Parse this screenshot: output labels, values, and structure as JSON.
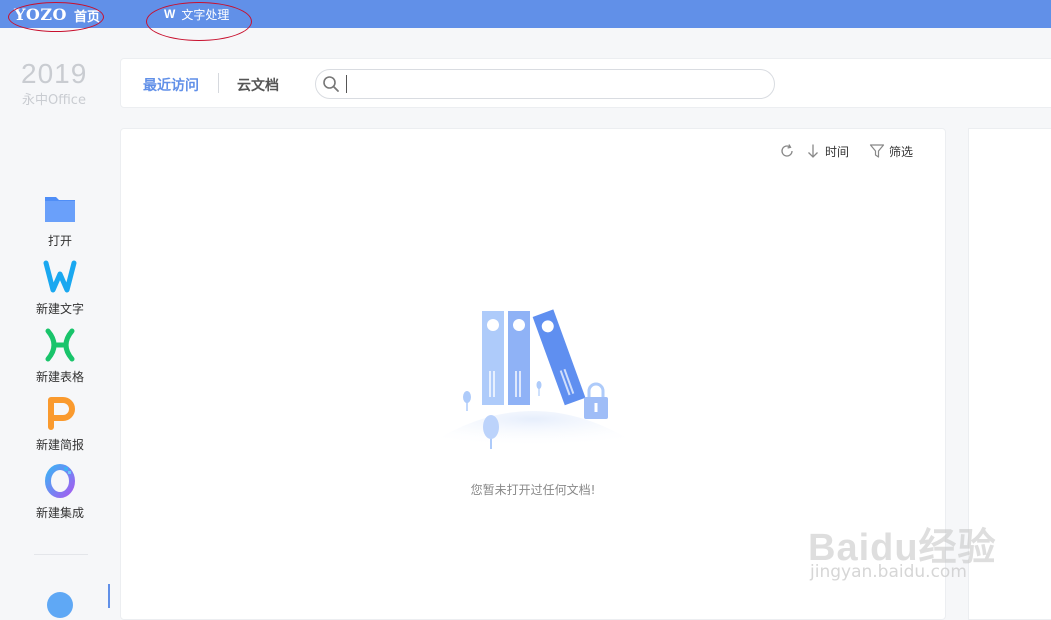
{
  "topbar": {
    "logo": "YOZO",
    "home_tab": "首页",
    "doc_tab_icon": "W",
    "doc_tab_label": "文字处理"
  },
  "brand": {
    "year": "2019",
    "name": "永中Office"
  },
  "sidebar": {
    "items": [
      {
        "label": "打开",
        "icon": "folder-icon",
        "color": "#4f8ef7"
      },
      {
        "label": "新建文字",
        "icon": "writer-w-icon",
        "color": "#1aa8f0"
      },
      {
        "label": "新建表格",
        "icon": "spreadsheet-x-icon",
        "color": "#19c46b"
      },
      {
        "label": "新建简报",
        "icon": "presentation-p-icon",
        "color": "#fa9a2e"
      },
      {
        "label": "新建集成",
        "icon": "integrated-icon",
        "color": "#8c6cf0"
      }
    ]
  },
  "header": {
    "tab_recent": "最近访问",
    "tab_cloud": "云文档",
    "search_placeholder": ""
  },
  "toolbar": {
    "sort_label": "时间",
    "filter_label": "筛选"
  },
  "empty": {
    "message": "您暂未打开过任何文档!"
  },
  "watermark": {
    "main": "Baidu经验",
    "sub": "jingyan.baidu.com"
  },
  "colors": {
    "accent": "#6190e8",
    "annotation_red": "#c8102e"
  }
}
